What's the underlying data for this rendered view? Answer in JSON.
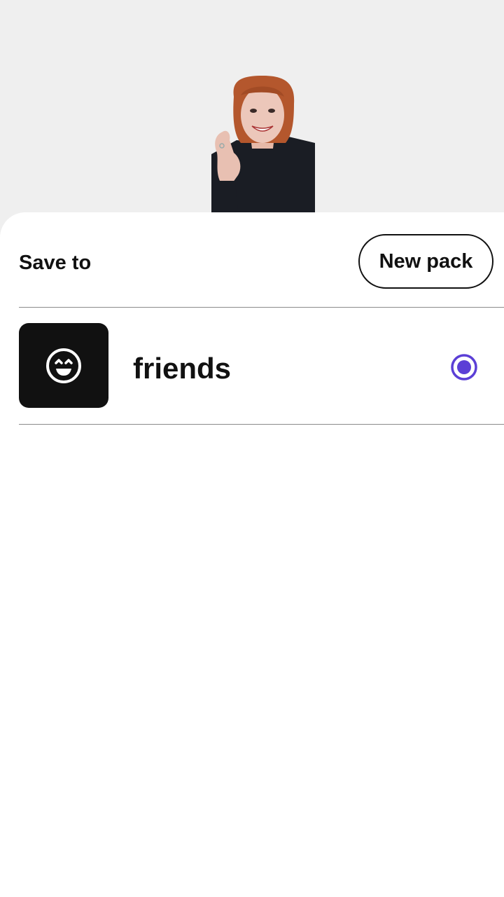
{
  "preview": {
    "sticker_icon": "person-sticker-preview"
  },
  "sheet": {
    "title": "Save to",
    "new_pack_label": "New pack"
  },
  "packs": [
    {
      "name": "friends",
      "icon": "smiley-icon",
      "selected": true
    }
  ],
  "colors": {
    "accent": "#5b3fd6",
    "background": "#efefef",
    "sheet": "#ffffff",
    "thumb": "#111111"
  }
}
